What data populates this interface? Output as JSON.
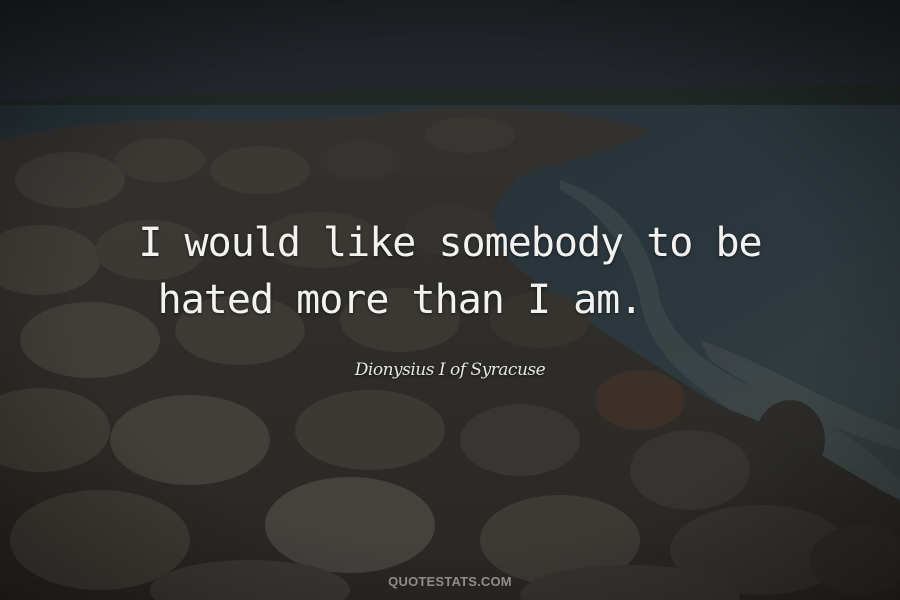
{
  "quote": {
    "line_1": "I would like somebody to be",
    "line_2": "hated more than I am.",
    "author": "Dionysius I of Syracuse"
  },
  "watermark": {
    "text": "QUOTESTATS.COM"
  },
  "colors": {
    "sky": "#2b2f36",
    "sea": "#3b4a52",
    "rocks": "#5a5149",
    "text": "#f2f2f0"
  }
}
